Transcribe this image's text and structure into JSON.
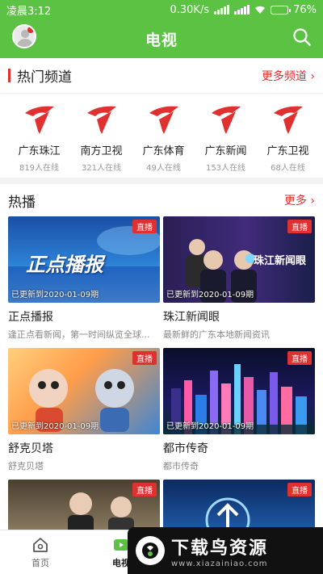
{
  "status_bar": {
    "time": "凌晨3:12",
    "speed": "0.30K/s",
    "battery": "76%",
    "battery_level": 0.76
  },
  "header": {
    "title": "电视",
    "search_icon": "search-icon",
    "avatar_icon": "avatar"
  },
  "hot_channels": {
    "title": "热门频道",
    "more_label": "更多频道 ›",
    "items": [
      {
        "name": "广东珠江",
        "online": "819人在线"
      },
      {
        "name": "南方卫视",
        "online": "321人在线"
      },
      {
        "name": "广东体育",
        "online": "49人在线"
      },
      {
        "name": "广东新闻",
        "online": "153人在线"
      },
      {
        "name": "广东卫视",
        "online": "68人在线"
      }
    ]
  },
  "hot": {
    "title": "热播",
    "more_label": "更多 ›",
    "items": [
      {
        "title": "正点播报",
        "subtitle": "逢正点看新闻，第一时间纵览全球...",
        "badge": "直播",
        "updated": "已更新到2020-01-09期",
        "art_text": "正点播报"
      },
      {
        "title": "珠江新闻眼",
        "subtitle": "最新鲜的广东本地新闻资讯",
        "badge": "直播",
        "updated": "已更新到2020-01-09期",
        "art_text": "珠江新闻眼"
      },
      {
        "title": "舒克贝塔",
        "subtitle": "舒克贝塔",
        "badge": "直播",
        "updated": "已更新到2020-01-09期",
        "art_text": ""
      },
      {
        "title": "都市传奇",
        "subtitle": "都市传奇",
        "badge": "直播",
        "updated": "已更新到2020-01-09期",
        "art_text": ""
      },
      {
        "title": "",
        "subtitle": "",
        "badge": "直播",
        "updated": "",
        "art_text": ""
      },
      {
        "title": "",
        "subtitle": "",
        "badge": "直播",
        "updated": "",
        "art_text": ""
      }
    ]
  },
  "bottom_nav": {
    "items": [
      {
        "label": "首页",
        "icon": "home-icon"
      },
      {
        "label": "电视",
        "icon": "tv-icon"
      }
    ]
  },
  "watermark": {
    "title": "下载鸟资源",
    "url": "www.xiazainiao.com"
  },
  "colors": {
    "brand_green": "#5bc244",
    "accent_red": "#e03131"
  }
}
